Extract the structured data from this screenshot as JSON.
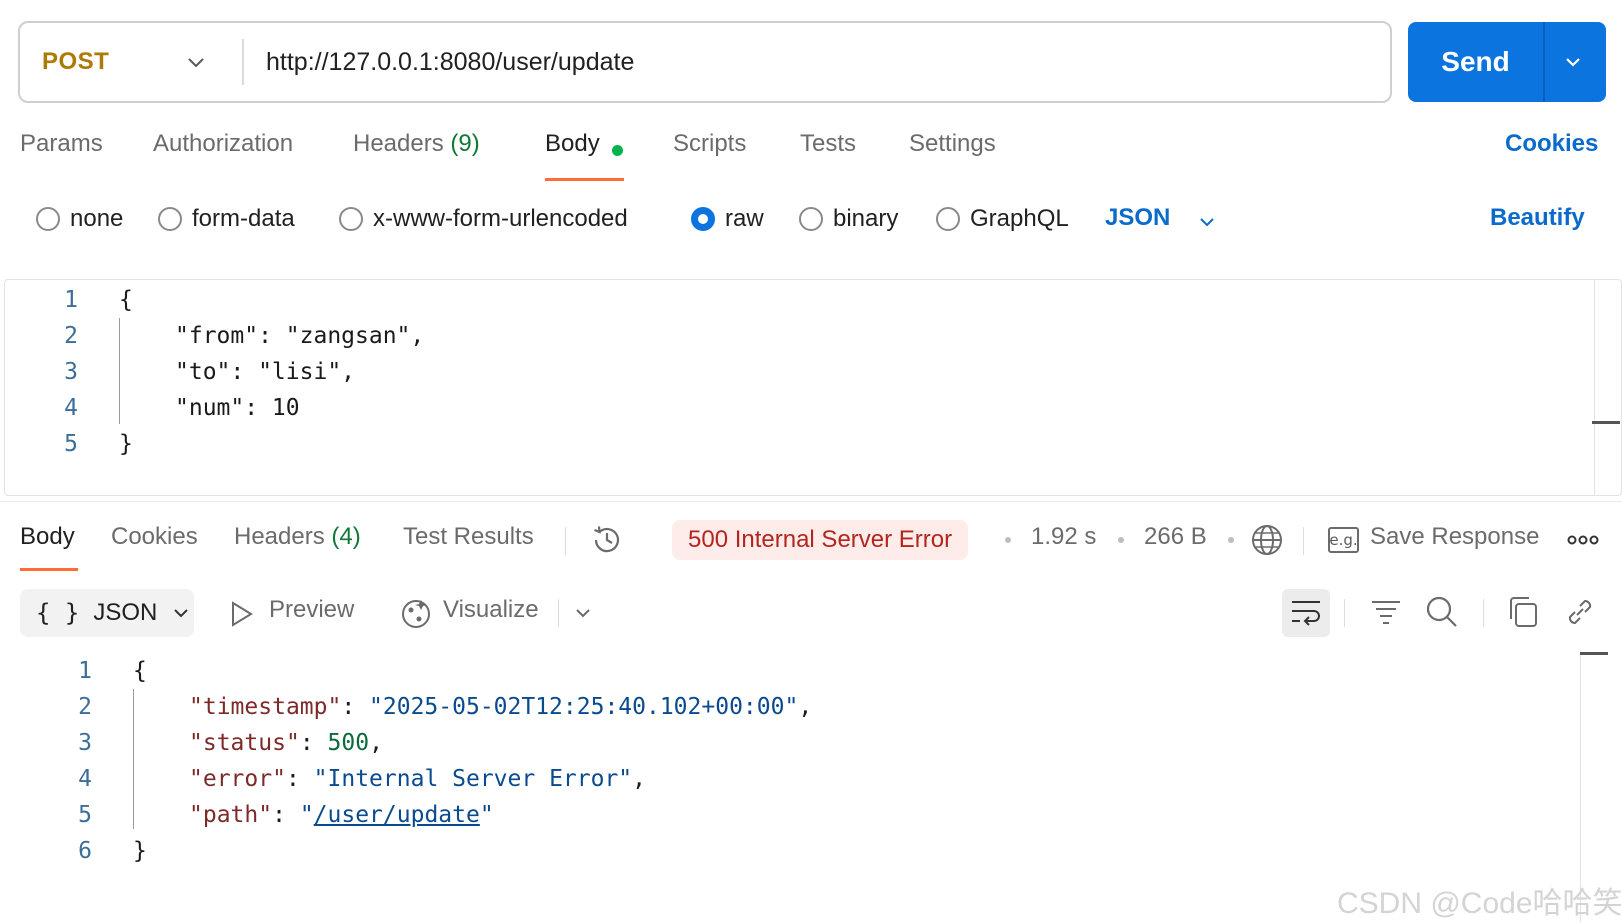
{
  "request": {
    "method": "POST",
    "url": "http://127.0.0.1:8080/user/update",
    "send_label": "Send"
  },
  "request_tabs": {
    "params": "Params",
    "authorization": "Authorization",
    "headers": "Headers",
    "headers_count": "(9)",
    "body": "Body",
    "scripts": "Scripts",
    "tests": "Tests",
    "settings": "Settings",
    "cookies": "Cookies"
  },
  "body_types": {
    "none": "none",
    "form_data": "form-data",
    "urlencoded": "x-www-form-urlencoded",
    "raw": "raw",
    "binary": "binary",
    "graphql": "GraphQL",
    "selected": "raw",
    "format": "JSON",
    "beautify": "Beautify"
  },
  "request_body": {
    "line_numbers": [
      "1",
      "2",
      "3",
      "4",
      "5"
    ],
    "open_brace": "{",
    "close_brace": "}",
    "lines": [
      "\"from\": \"zangsan\",",
      "\"to\": \"lisi\",",
      "\"num\": 10"
    ]
  },
  "response_tabs": {
    "body": "Body",
    "cookies": "Cookies",
    "headers": "Headers",
    "headers_count": "(4)",
    "test_results": "Test Results"
  },
  "response_meta": {
    "status": "500 Internal Server Error",
    "time": "1.92 s",
    "size": "266 B",
    "save_response": "Save Response",
    "eg_label": "e.g."
  },
  "response_toolbar": {
    "braces": "{ }",
    "format": "JSON",
    "preview": "Preview",
    "visualize": "Visualize"
  },
  "response_body": {
    "line_numbers": [
      "1",
      "2",
      "3",
      "4",
      "5",
      "6"
    ],
    "open_brace": "{",
    "close_brace": "}",
    "q": "\"",
    "colon": ": ",
    "comma": ",",
    "timestamp_key": "timestamp",
    "timestamp_value": "\"2025-05-02T12:25:40.102+00:00\"",
    "status_key": "status",
    "status_value": "500",
    "error_key": "error",
    "error_value": "\"Internal Server Error\"",
    "path_key": "path",
    "path_value": "/user/update"
  },
  "watermark": "CSDN @Code哈哈笑",
  "colors": {
    "accent": "#0b74de",
    "method": "#ad7a03",
    "tab_underline": "#ff6c37",
    "status_bg": "#fdecea",
    "status_text": "#b3261e"
  },
  "icons": [
    "chevron-down-icon",
    "history-icon",
    "globe-icon",
    "more-icon",
    "play-icon",
    "visualize-icon",
    "wrap-lines-icon",
    "filter-icon",
    "search-icon",
    "copy-icon",
    "link-icon"
  ]
}
